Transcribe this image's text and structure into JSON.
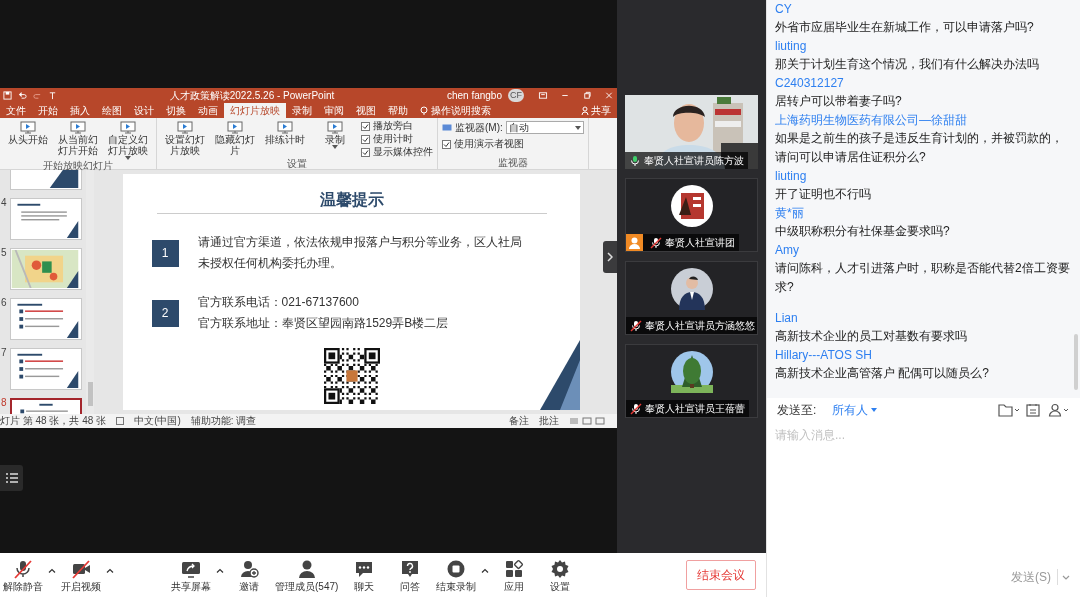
{
  "presentation": {
    "title": "人才政策解读2022.5.26 - PowerPoint",
    "user_name": "chen fangbo",
    "user_initials": "CF",
    "tabs": [
      {
        "label": "文件",
        "selected": false
      },
      {
        "label": "开始",
        "selected": false
      },
      {
        "label": "插入",
        "selected": false
      },
      {
        "label": "绘图",
        "selected": false
      },
      {
        "label": "设计",
        "selected": false
      },
      {
        "label": "切换",
        "selected": false
      },
      {
        "label": "动画",
        "selected": false
      },
      {
        "label": "幻灯片放映",
        "selected": true
      },
      {
        "label": "录制",
        "selected": false
      },
      {
        "label": "审阅",
        "selected": false
      },
      {
        "label": "视图",
        "selected": false
      },
      {
        "label": "帮助",
        "selected": false
      }
    ],
    "search_label": "操作说明搜索",
    "share_label": "共享",
    "ribbon_groups": [
      {
        "label": "开始放映幻灯片",
        "items": [
          {
            "kind": "button",
            "label": "从头开始"
          },
          {
            "kind": "button",
            "label": "从当前幻灯片开始"
          },
          {
            "kind": "button",
            "label": "自定义幻灯片放映",
            "has_menu": true
          }
        ]
      },
      {
        "label": "设置",
        "items": [
          {
            "kind": "button",
            "label": "设置幻灯片放映"
          },
          {
            "kind": "button",
            "label": "隐藏幻灯片"
          },
          {
            "kind": "button",
            "label": "排练计时"
          },
          {
            "kind": "button",
            "label": "录制",
            "has_menu": true
          },
          {
            "kind": "checks",
            "options": [
              {
                "label": "播放旁白",
                "checked": true
              },
              {
                "label": "使用计时",
                "checked": true
              },
              {
                "label": "显示媒体控件",
                "checked": true
              }
            ]
          }
        ]
      },
      {
        "label": "监视器",
        "items": [
          {
            "kind": "dropdown",
            "label": "监视器(M):",
            "value": "自动"
          },
          {
            "kind": "checks",
            "options": [
              {
                "label": "使用演示者视图",
                "checked": true
              }
            ]
          }
        ]
      }
    ],
    "thumbnails": [
      {
        "kind": "title",
        "selected": false
      },
      {
        "number": "4",
        "kind": "text",
        "selected": false
      },
      {
        "number": "5",
        "kind": "map",
        "selected": false
      },
      {
        "number": "6",
        "kind": "list",
        "selected": false
      },
      {
        "number": "7",
        "kind": "list",
        "selected": false
      },
      {
        "number": "8",
        "kind": "notice",
        "selected": true
      }
    ],
    "slide": {
      "title": "温馨提示",
      "items": [
        {
          "number": "1",
          "lines": [
            "请通过官方渠道，依法依规申报落户与积分等业务，区人社局未授权任何机构委托办理。"
          ]
        },
        {
          "number": "2",
          "lines": [
            "官方联系电话：021-67137600",
            "官方联系地址：奉贤区望园南路1529弄B楼二层"
          ]
        }
      ]
    },
    "status_bar": {
      "slide_info": "灯片 第 48 张，共 48 张",
      "language": "中文(中国)",
      "accessibility": "辅助功能: 调查",
      "notes": "备注",
      "comments": "批注"
    }
  },
  "participants": [
    {
      "name": "奉贤人社宣讲员陈方波",
      "kind": "video",
      "muted": false,
      "host": false
    },
    {
      "name": "奉贤人社宣讲团",
      "kind": "logo",
      "muted": true,
      "host": true
    },
    {
      "name": "奉贤人社宣讲员方涵悠悠",
      "muted": true,
      "host": false
    },
    {
      "name": "奉贤人社宣讲员王蓓蕾",
      "kind": "tree",
      "muted": true,
      "host": false
    }
  ],
  "chat": {
    "messages": [
      {
        "sender": "CY",
        "text": "外省市应届毕业生在新城工作，可以申请落户吗?"
      },
      {
        "sender": "liuting",
        "text": "那关于计划生育这个情况，我们有什么解决办法吗"
      },
      {
        "sender": "C240312127",
        "text": "居转户可以带着妻子吗?"
      },
      {
        "sender": "上海药明生物医药有限公司—徐甜甜",
        "text": "如果是之前生的孩子是违反生育计划的，并被罚款的，请问可以申请居住证积分么?"
      },
      {
        "sender": "liuting",
        "text": "开了证明也不行吗"
      },
      {
        "sender": "黄*丽",
        "text": "中级职称积分有社保基金要求吗?"
      },
      {
        "sender": "Amy",
        "text": "请问陈科，人才引进落户时，职称是否能代替2倍工资要求?"
      },
      {
        "sender": "Lian",
        "text": "高新技术企业的员工对基数有要求吗"
      },
      {
        "sender": "Hillary---ATOS SH",
        "text": "高新技术企业高管落户 配偶可以随员么?"
      }
    ],
    "send_to_label": "发送至:",
    "recipient": "所有人",
    "placeholder": "请输入消息...",
    "send_button": "发送(S)"
  },
  "toolbar": {
    "left": [
      {
        "kind": "mic",
        "label": "解除静音",
        "off": true,
        "menu": true
      },
      {
        "kind": "camera",
        "label": "开启视频",
        "off": true,
        "menu": true
      }
    ],
    "center": [
      {
        "kind": "share",
        "label": "共享屏幕",
        "menu": true
      },
      {
        "kind": "invite",
        "label": "邀请",
        "menu": false
      },
      {
        "kind": "members",
        "label": "管理成员(547)",
        "menu": false
      },
      {
        "kind": "chat",
        "label": "聊天",
        "menu": false
      },
      {
        "kind": "qa",
        "label": "问答",
        "menu": false
      },
      {
        "kind": "record",
        "label": "结束录制",
        "menu": true
      },
      {
        "kind": "apps",
        "label": "应用",
        "menu": false
      },
      {
        "kind": "settings",
        "label": "设置",
        "menu": false
      }
    ],
    "end_button": "结束会议"
  }
}
